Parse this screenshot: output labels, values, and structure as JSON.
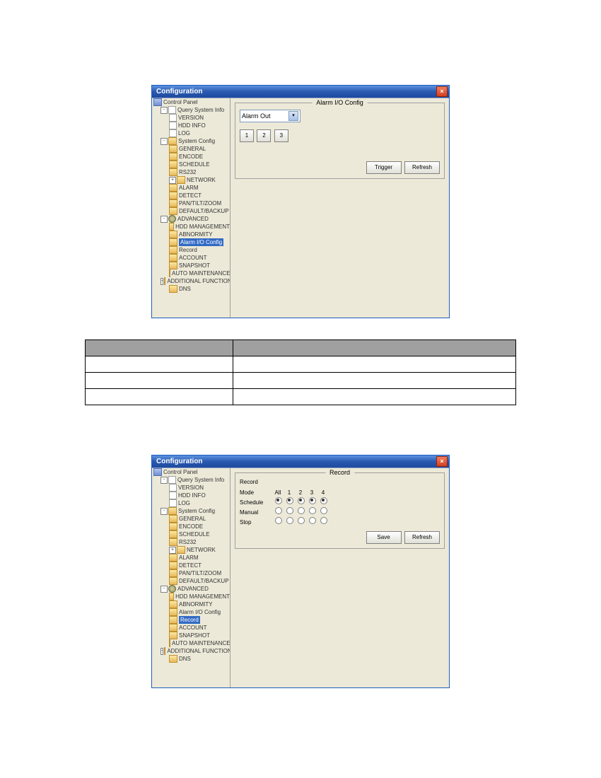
{
  "window1": {
    "title": "Configuration",
    "panel_title": "Alarm I/O Config",
    "dropdown": "Alarm Out",
    "btn1": "1",
    "btn2": "2",
    "btn3": "3",
    "trigger": "Trigger",
    "refresh": "Refresh"
  },
  "window2": {
    "title": "Configuration",
    "panel_title": "Record",
    "group": "Record",
    "mode": "Mode",
    "labels": {
      "all": "All",
      "c1": "1",
      "c2": "2",
      "c3": "3",
      "c4": "4"
    },
    "rows": {
      "schedule": "Schedule",
      "manual": "Manual",
      "stop": "Stop"
    },
    "save": "Save",
    "refresh": "Refresh"
  },
  "tree": {
    "root": "Control Panel",
    "query": "Query System Info",
    "version": "VERSION",
    "hddinfo": "HDD INFO",
    "log": "LOG",
    "syscfg": "System Config",
    "general": "GENERAL",
    "encode": "ENCODE",
    "schedule": "SCHEDULE",
    "rs232": "RS232",
    "network": "NETWORK",
    "alarm": "ALARM",
    "detect": "DETECT",
    "ptz": "PAN/TILT/ZOOM",
    "defbak": "DEFAULT/BACKUP",
    "advanced": "ADVANCED",
    "hddmgmt": "HDD MANAGEMENT",
    "abnormity": "ABNORMITY",
    "alarmio": "Alarm I/O Config",
    "record": "Record",
    "account": "ACCOUNT",
    "snapshot": "SNAPSHOT",
    "automaint": "AUTO MAINTENANCE",
    "addfunc": "ADDITIONAL FUNCTION",
    "dns": "DNS"
  },
  "table": {
    "h1": "",
    "h2": "",
    "r1c1": "",
    "r1c2": "",
    "r2c1": "",
    "r2c2": "",
    "r3c1": "",
    "r3c2": ""
  }
}
